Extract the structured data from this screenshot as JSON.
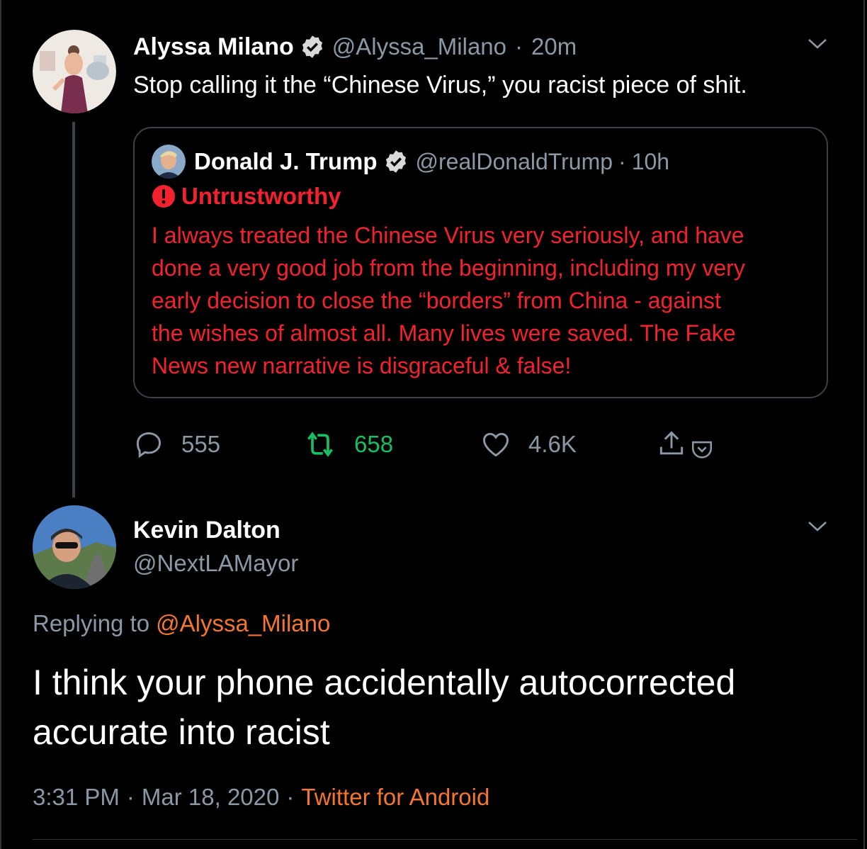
{
  "tweet1": {
    "name": "Alyssa Milano",
    "handle": "@Alyssa_Milano",
    "sep": "·",
    "time": "20m",
    "text": "Stop calling it the “Chinese Virus,” you racist piece of shit.",
    "quote": {
      "name": "Donald J. Trump",
      "handle": "@realDonaldTrump",
      "sep": "·",
      "time": "10h",
      "label": "Untrustworthy",
      "lines": [
        "I always treated the Chinese Virus very seriously, and have",
        "done a very good job from the beginning, including my very",
        "early decision to close the “borders” from China - against",
        "the wishes of almost all. Many lives were saved. The Fake",
        "News new narrative is disgraceful & false!"
      ]
    },
    "stats": {
      "replies": "555",
      "retweets": "658",
      "likes": "4.6K"
    }
  },
  "tweet2": {
    "name": "Kevin Dalton",
    "handle": "@NextLAMayor",
    "replying_prefix": "Replying to",
    "replying_handle": "@Alyssa_Milano",
    "text": "I think your phone accidentally autocorrected accurate into racist",
    "time": "3:31 PM",
    "sep1": "·",
    "date": "Mar 18, 2020",
    "sep2": "·",
    "source": "Twitter for Android"
  },
  "colors": {
    "background": "#000000",
    "muted": "#8b98a5",
    "warning_red": "#f4212e",
    "retweet_green": "#17bf63",
    "link_orange": "#f4762f"
  },
  "icons": [
    "verified-badge-icon",
    "chevron-down-icon",
    "alert-icon",
    "reply-icon",
    "retweet-icon",
    "like-icon",
    "share-icon",
    "pocket-icon"
  ]
}
